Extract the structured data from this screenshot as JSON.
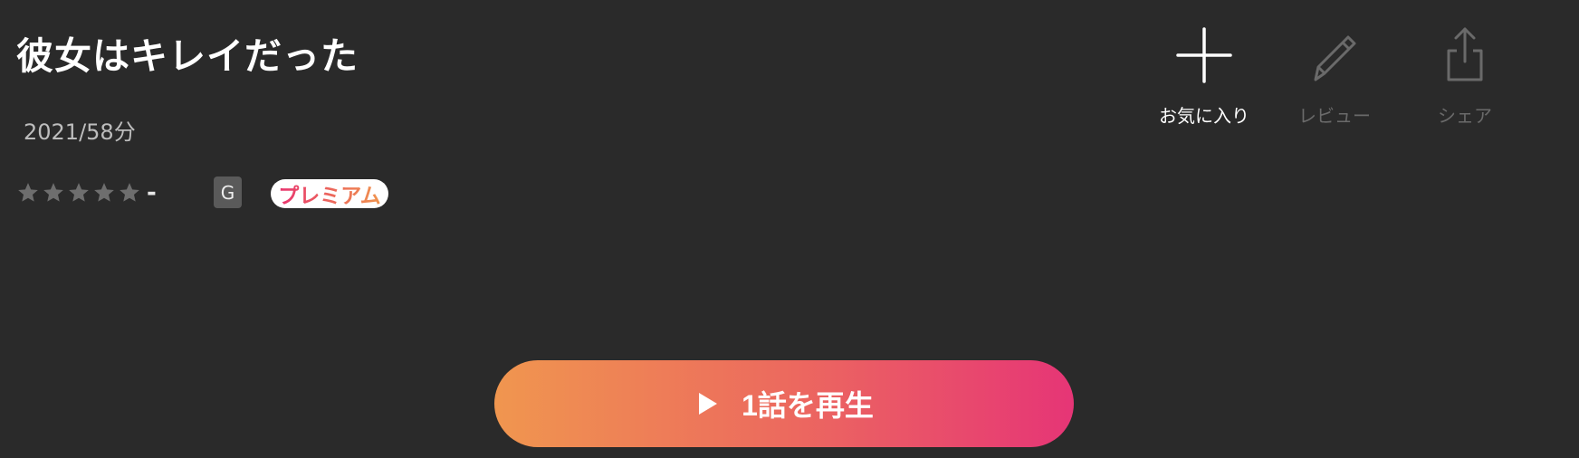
{
  "title": "彼女はキレイだった",
  "meta": "2021/58分",
  "rating": {
    "stars_filled": 0,
    "stars_total": 5,
    "score": "-",
    "star_color": "#6e6e6e"
  },
  "age_rating": "G",
  "badge": {
    "label": "プレミアム"
  },
  "actions": [
    {
      "label": "お気に入り",
      "icon": "plus-icon",
      "enabled": true
    },
    {
      "label": "レビュー",
      "icon": "pencil-icon",
      "enabled": false
    },
    {
      "label": "シェア",
      "icon": "share-icon",
      "enabled": false
    }
  ],
  "play": {
    "label": "1話を再生",
    "icon": "play-icon"
  },
  "colors": {
    "background": "#2a2a2a",
    "accent_start": "#f0964f",
    "accent_end": "#e63576",
    "disabled": "#6a6a6a"
  }
}
